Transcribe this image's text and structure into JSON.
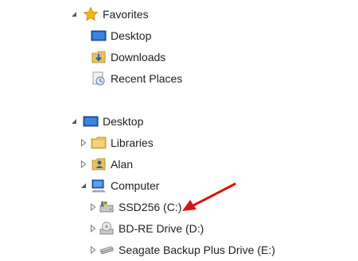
{
  "nav": {
    "favorites": {
      "label": "Favorites",
      "items": [
        {
          "label": "Desktop"
        },
        {
          "label": "Downloads"
        },
        {
          "label": "Recent Places"
        }
      ]
    },
    "desktop": {
      "label": "Desktop",
      "items": [
        {
          "label": "Libraries"
        },
        {
          "label": "Alan"
        }
      ],
      "computer": {
        "label": "Computer",
        "drives": [
          {
            "label": "SSD256 (C:)"
          },
          {
            "label": "BD-RE Drive (D:)"
          },
          {
            "label": "Seagate Backup Plus Drive (E:)"
          }
        ]
      }
    }
  },
  "annotation": {
    "arrow_color": "#e01010"
  },
  "colors": {
    "tree_arrow": "#595959",
    "star": "#f5b800",
    "folder": "#e8c15a"
  }
}
